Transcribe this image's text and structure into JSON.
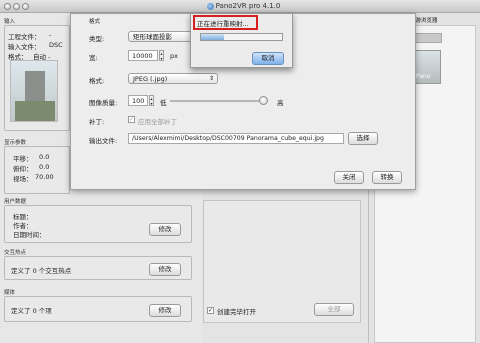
{
  "window": {
    "title": "Pano2VR pro 4.1.0"
  },
  "left": {
    "input_section": {
      "header": "输入",
      "project_label": "工程文件：",
      "project_value": "-",
      "input_label": "输入文件：",
      "input_value": "DSC",
      "format_label": "格式：",
      "format_value": "自动 -"
    },
    "display_section": {
      "header": "显示参数",
      "pan_label": "平移：",
      "pan_value": "0.0",
      "tilt_label": "俯仰：",
      "tilt_value": "0.0",
      "fov_label": "视场：",
      "fov_value": "70.00"
    },
    "user_section": {
      "header": "用户数据",
      "title_label": "标题：",
      "author_label": "作者：",
      "date_label": "日期时间：",
      "modify": "修改"
    },
    "hotspot_section": {
      "header": "交互热点",
      "text": "定义了 0 个交互热点",
      "modify": "修改"
    },
    "media_section": {
      "header": "媒体",
      "text": "定义了 0 个项",
      "modify": "修改"
    }
  },
  "right": {
    "header": "漫游浏览器",
    "thumb_label": "Pano"
  },
  "dialog": {
    "header": "格式",
    "type_label": "类型:",
    "type_value": "矩形球面投影",
    "width_label": "宽:",
    "width_value": "10000",
    "width_unit": "px",
    "format_label": "格式:",
    "format_value": "JPEG (.jpg)",
    "quality_label": "图像质量:",
    "quality_value": "100",
    "quality_low": "低",
    "quality_high": "高",
    "quality_level": 1.0,
    "patch_label": "补丁:",
    "patch_checkbox": "应用全部补丁",
    "output_label": "输出文件:",
    "output_value": "/Users/Alexmimi/Desktop/DSC00709 Panorama_cube_equi.jpg",
    "choose_button": "选择",
    "close_button": "关闭",
    "convert_button": "转换"
  },
  "progress": {
    "text": "正在进行重映射...",
    "cancel": "取消",
    "fill": 0.28,
    "highlight_color": "#d62020"
  },
  "bottom": {
    "open_after": "创建完毕打开",
    "all_button": "全部"
  }
}
